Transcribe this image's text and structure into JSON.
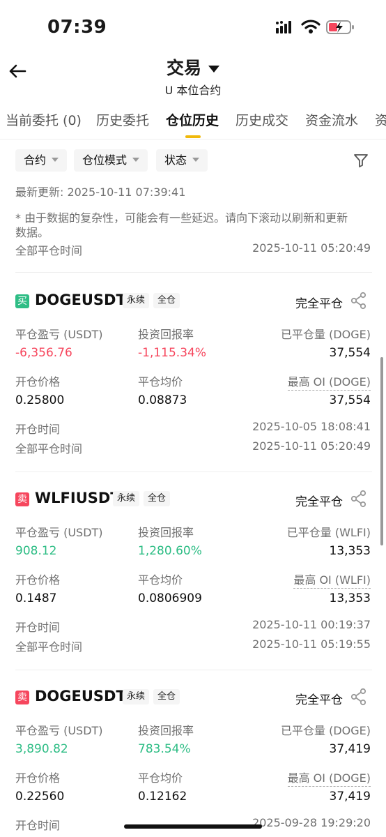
{
  "status_bar": {
    "time": "07:39"
  },
  "header": {
    "title": "交易",
    "subtitle": "U 本位合约"
  },
  "tabs": [
    {
      "label": "当前委托 (0)"
    },
    {
      "label": "历史委托"
    },
    {
      "label": "仓位历史"
    },
    {
      "label": "历史成交"
    },
    {
      "label": "资金流水"
    },
    {
      "label": "资"
    }
  ],
  "filters": {
    "contract": "合约",
    "position_mode": "仓位模式",
    "status": "状态"
  },
  "last_update": "最新更新: 2025-10-11 07:39:41",
  "notice": "* 由于数据的复杂性，可能会有一些延迟。请向下滚动以刷新和更新数据。",
  "top_row": {
    "label": "全部平仓时间",
    "value": "2025-10-11 05:20:49"
  },
  "labels": {
    "pnl": "平仓盈亏 (USDT)",
    "roi": "投资回报率",
    "open_price": "开仓价格",
    "close_avg": "平仓均价",
    "open_time": "开仓时间",
    "close_time": "全部平仓时间"
  },
  "cards": [
    {
      "side": "买",
      "symbol": "DOGEUSDT",
      "tag1": "永续",
      "tag2": "全仓",
      "status": "完全平仓",
      "pnl": "-6,356.76",
      "roi": "-1,115.34%",
      "closed_qty_label": "已平仓量 (DOGE)",
      "closed_qty": "37,554",
      "open_price": "0.25800",
      "close_avg": "0.08873",
      "max_oi_label": "最高 OI (DOGE)",
      "max_oi": "37,554",
      "open_time": "2025-10-05 18:08:41",
      "close_time": "2025-10-11 05:20:49"
    },
    {
      "side": "卖",
      "symbol": "WLFIUSDT",
      "tag1": "永续",
      "tag2": "全仓",
      "status": "完全平仓",
      "pnl": "908.12",
      "roi": "1,280.60%",
      "closed_qty_label": "已平仓量 (WLFI)",
      "closed_qty": "13,353",
      "open_price": "0.1487",
      "close_avg": "0.0806909",
      "max_oi_label": "最高 OI (WLFI)",
      "max_oi": "13,353",
      "open_time": "2025-10-11 00:19:37",
      "close_time": "2025-10-11 05:19:55"
    },
    {
      "side": "卖",
      "symbol": "DOGEUSDT",
      "tag1": "永续",
      "tag2": "全仓",
      "status": "完全平仓",
      "pnl": "3,890.82",
      "roi": "783.54%",
      "closed_qty_label": "已平仓量 (DOGE)",
      "closed_qty": "37,419",
      "open_price": "0.22560",
      "close_avg": "0.12162",
      "max_oi_label": "最高 OI (DOGE)",
      "max_oi": "37,419",
      "open_time": "2025-09-28 19:29:20"
    }
  ],
  "colors": {
    "accent": "#f0b90b",
    "profit": "#2ebd85",
    "loss": "#f6465d"
  },
  "icons": [
    "back-arrow-icon",
    "caret-down-icon",
    "filter-icon",
    "share-icon",
    "signal-icon",
    "wifi-icon",
    "battery-charging-icon"
  ]
}
